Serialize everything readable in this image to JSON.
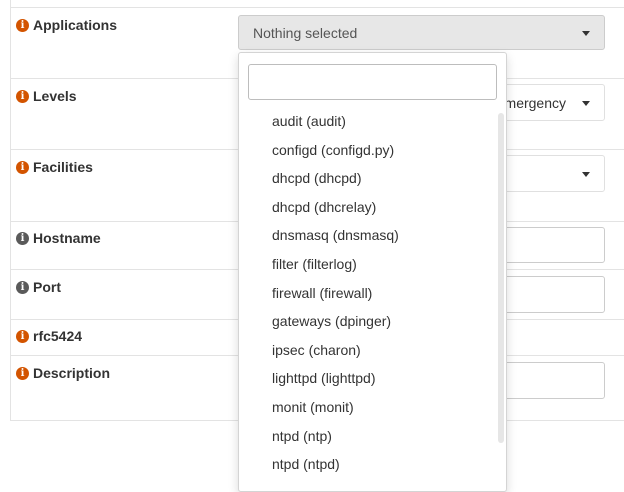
{
  "rows": {
    "applications": "Applications",
    "levels": "Levels",
    "facilities": "Facilities",
    "hostname": "Hostname",
    "port": "Port",
    "rfc5424": "rfc5424",
    "description": "Description"
  },
  "applications_select": {
    "value": "Nothing selected"
  },
  "levels_select": {
    "partial_value": "mergency"
  },
  "dropdown": {
    "search_value": "",
    "items": [
      "audit (audit)",
      "configd (configd.py)",
      "dhcpd (dhcpd)",
      "dhcpd (dhcrelay)",
      "dnsmasq (dnsmasq)",
      "filter (filterlog)",
      "firewall (firewall)",
      "gateways (dpinger)",
      "ipsec (charon)",
      "lighttpd (lighttpd)",
      "monit (monit)",
      "ntpd (ntp)",
      "ntpd (ntpd)"
    ]
  },
  "icons": {
    "info": "i",
    "info_icon_color": "#d35400",
    "info_icon_grey": "#5a5a5a"
  }
}
